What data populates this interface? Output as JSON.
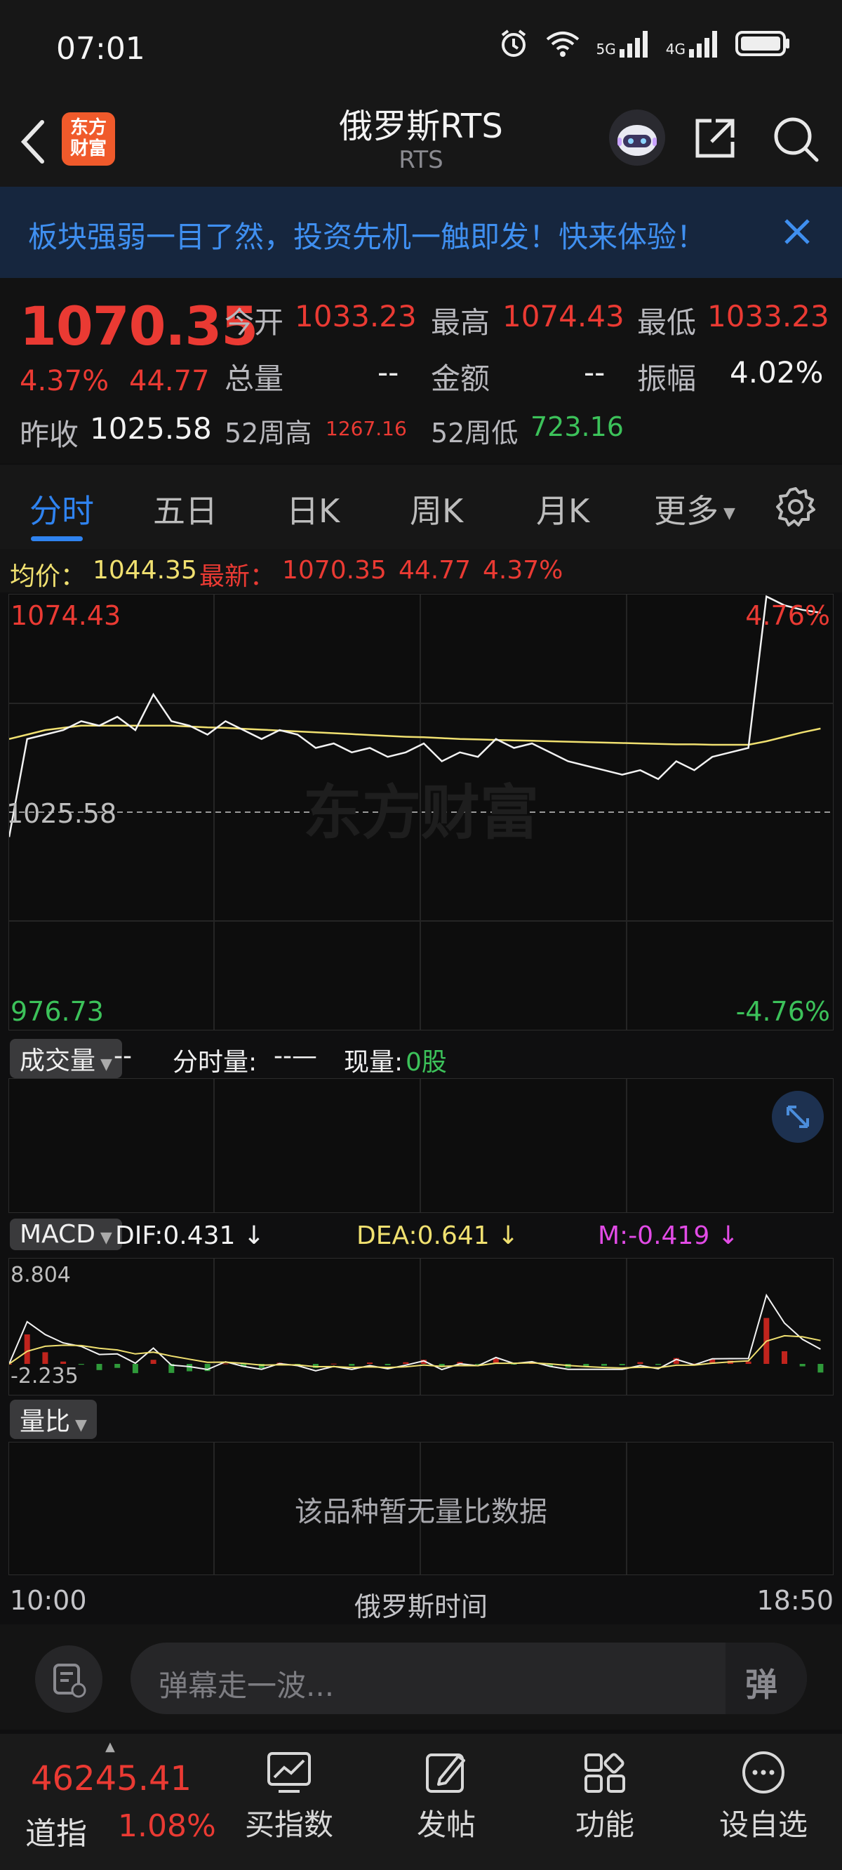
{
  "status_bar": {
    "time": "07:01",
    "net1": "5G",
    "net2": "4G"
  },
  "header": {
    "logo_text": "东方\n财富",
    "title": "俄罗斯RTS",
    "subtitle": "RTS"
  },
  "banner": {
    "text": "板块强弱一目了然，投资先机一触即发！快来体验！"
  },
  "quote": {
    "price": "1070.35",
    "change_pct": "4.37%",
    "change": "44.77",
    "open_label": "今开",
    "open": "1033.23",
    "high_label": "最高",
    "high": "1074.43",
    "low_label": "最低",
    "low": "1033.23",
    "volume_label": "总量",
    "volume": "--",
    "amount_label": "金额",
    "amount": "--",
    "amplitude_label": "振幅",
    "amplitude": "4.02%",
    "prev_close_label": "昨收",
    "prev_close": "1025.58",
    "w52_high_label": "52周高",
    "w52_high": "1267.16",
    "w52_low_label": "52周低",
    "w52_low": "723.16"
  },
  "tabs": [
    "分时",
    "五日",
    "日K",
    "周K",
    "月K",
    "更多"
  ],
  "avg_line": {
    "avg_label": "均价：",
    "avg": "1044.35",
    "latest_label": "最新：",
    "latest": "1070.35",
    "change": "44.77",
    "pct": "4.37%"
  },
  "main_chart": {
    "y_top": "1074.43",
    "y_mid": "1025.58",
    "y_bottom": "976.73",
    "pct_top": "4.76%",
    "pct_bottom": "-4.76%",
    "watermark": "东方财富"
  },
  "volume_panel": {
    "chip": "成交量",
    "dash": "--",
    "fenshi_label": "分时量:",
    "fenshi_val": "--—",
    "now_label": "现量:",
    "now_val": "0股"
  },
  "macd_panel": {
    "chip": "MACD",
    "dif": "DIF:0.431",
    "dea": "DEA:0.641",
    "m": "M:-0.419",
    "y_top": "8.804",
    "y_bottom": "-2.235"
  },
  "ratio_panel": {
    "chip": "量比",
    "empty_text": "该品种暂无量比数据"
  },
  "x_axis": {
    "start": "10:00",
    "mid": "俄罗斯时间",
    "end": "18:50"
  },
  "comment": {
    "placeholder": "弹幕走一波..."
  },
  "tabbar": {
    "index_value": "46245.41",
    "index_name": "道指",
    "index_pct": "1.08%",
    "items": [
      "买指数",
      "发帖",
      "功能",
      "设自选"
    ]
  },
  "chart_data": {
    "type": "line",
    "title": "",
    "xlabel": "俄罗斯时间",
    "x_range": [
      "10:00",
      "18:50"
    ],
    "ylim": [
      976.73,
      1074.43
    ],
    "series": [
      {
        "name": "",
        "values": [
          1020,
          1042,
          1043,
          1044,
          1046,
          1045,
          1047,
          1044,
          1052,
          1046,
          1045,
          1043,
          1046,
          1044,
          1042,
          1044,
          1043,
          1040,
          1041,
          1039,
          1040,
          1038,
          1039,
          1041,
          1037,
          1039,
          1038,
          1042,
          1040,
          1041,
          1039,
          1037,
          1036,
          1035,
          1034,
          1035,
          1033,
          1037,
          1035,
          1038,
          1039,
          1040,
          1074,
          1072,
          1071,
          1070.35
        ]
      },
      {
        "name": "均价",
        "values": [
          1042,
          1043,
          1044,
          1044.5,
          1045,
          1045,
          1045,
          1045,
          1045,
          1045,
          1044.8,
          1044.6,
          1044.5,
          1044.3,
          1044.1,
          1043.9,
          1043.7,
          1043.5,
          1043.3,
          1043.1,
          1042.9,
          1042.7,
          1042.5,
          1042.4,
          1042.2,
          1042.0,
          1041.9,
          1041.8,
          1041.7,
          1041.6,
          1041.5,
          1041.4,
          1041.3,
          1041.2,
          1041.1,
          1041.0,
          1040.9,
          1040.8,
          1040.8,
          1040.7,
          1040.7,
          1040.7,
          1041.5,
          1042.5,
          1043.5,
          1044.35
        ]
      }
    ]
  }
}
